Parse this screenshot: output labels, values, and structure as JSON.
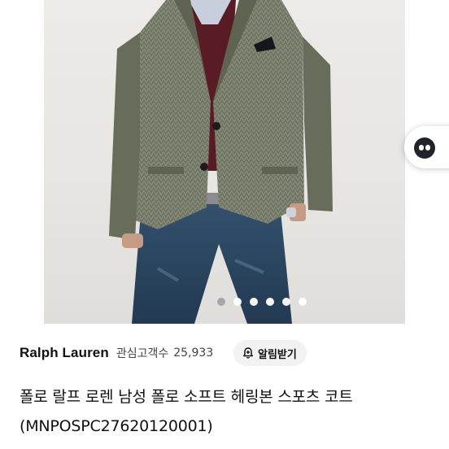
{
  "product": {
    "brand": "Ralph Lauren",
    "watch_label": "관심고객수",
    "watch_count": "25,933",
    "alert_button_label": "알림받기",
    "title_line1": "폴로 랄프 로렌 남성 폴로 소프트 헤링본 스포츠 코트",
    "title_line2": "(MNPOSPC27620120001)"
  },
  "gallery": {
    "active_index": 1,
    "count": 6
  },
  "colors": {
    "jacket": "#6f7463",
    "sweater": "#5a1c24",
    "jeans": "#2e4660",
    "pill_background": "#f2f2f2"
  }
}
